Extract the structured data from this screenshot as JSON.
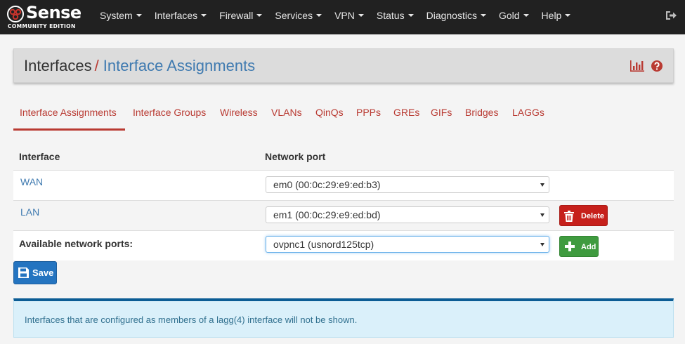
{
  "brand": {
    "name": "Sense",
    "edition": "COMMUNITY EDITION"
  },
  "nav": {
    "items": [
      {
        "label": "System"
      },
      {
        "label": "Interfaces"
      },
      {
        "label": "Firewall"
      },
      {
        "label": "Services"
      },
      {
        "label": "VPN"
      },
      {
        "label": "Status"
      },
      {
        "label": "Diagnostics"
      },
      {
        "label": "Gold"
      },
      {
        "label": "Help"
      }
    ],
    "logout_icon": "sign-out-icon"
  },
  "breadcrumb": {
    "parent": "Interfaces",
    "separator": "/",
    "current": "Interface Assignments",
    "icons": [
      "bar-chart-icon",
      "question-circle-icon"
    ]
  },
  "tabs": [
    {
      "label": "Interface Assignments",
      "active": true
    },
    {
      "label": "Interface Groups"
    },
    {
      "label": "Wireless"
    },
    {
      "label": "VLANs"
    },
    {
      "label": "QinQs"
    },
    {
      "label": "PPPs"
    },
    {
      "label": "GREs"
    },
    {
      "label": "GIFs"
    },
    {
      "label": "Bridges"
    },
    {
      "label": "LAGGs"
    }
  ],
  "table": {
    "headers": {
      "interface": "Interface",
      "port": "Network port"
    },
    "rows": [
      {
        "interface": "WAN",
        "port": "em0 (00:0c:29:e9:ed:b3)"
      },
      {
        "interface": "LAN",
        "port": "em1 (00:0c:29:e9:ed:bd)",
        "action": "Delete"
      }
    ],
    "available": {
      "label": "Available network ports:",
      "port": "ovpnc1 (usnord125tcp)",
      "action": "Add"
    }
  },
  "save_label": "Save",
  "info_text": "Interfaces that are configured as members of a lagg(4) interface will not be shown.",
  "colors": {
    "navbar": "#212121",
    "accent_red": "#b93a32",
    "link_blue": "#3f7ab0",
    "danger": "#c6201b",
    "success": "#3f9b3f",
    "primary": "#2474c0",
    "info_bg": "#daf0fa",
    "info_border": "#0b5c94"
  }
}
